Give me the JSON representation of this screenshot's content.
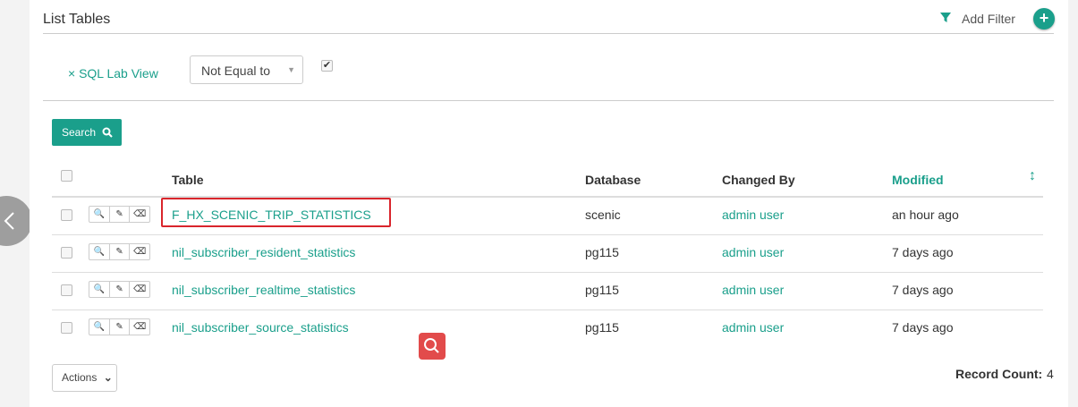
{
  "header": {
    "title": "List Tables",
    "add_filter_label": "Add Filter",
    "add_button_label": "+"
  },
  "filter": {
    "remove_label": "×",
    "column_label": "SQL Lab View",
    "operator": "Not Equal to",
    "value_checked": true
  },
  "search": {
    "label": "Search"
  },
  "table": {
    "columns": {
      "table": "Table",
      "database": "Database",
      "changed_by": "Changed By",
      "modified": "Modified"
    },
    "rows": [
      {
        "name": "F_HX_SCENIC_TRIP_STATISTICS",
        "database": "scenic",
        "changed_by": "admin user",
        "modified": "an hour ago"
      },
      {
        "name": "nil_subscriber_resident_statistics",
        "database": "pg115",
        "changed_by": "admin user",
        "modified": "7 days ago"
      },
      {
        "name": "nil_subscriber_realtime_statistics",
        "database": "pg115",
        "changed_by": "admin user",
        "modified": "7 days ago"
      },
      {
        "name": "nil_subscriber_source_statistics",
        "database": "pg115",
        "changed_by": "admin user",
        "modified": "7 days ago"
      }
    ]
  },
  "footer": {
    "actions_label": "Actions",
    "record_count_label": "Record Count:",
    "record_count": "4"
  },
  "colors": {
    "accent": "#1a9f8b",
    "highlight": "#d9252c",
    "floating_search": "#e24b4b"
  }
}
